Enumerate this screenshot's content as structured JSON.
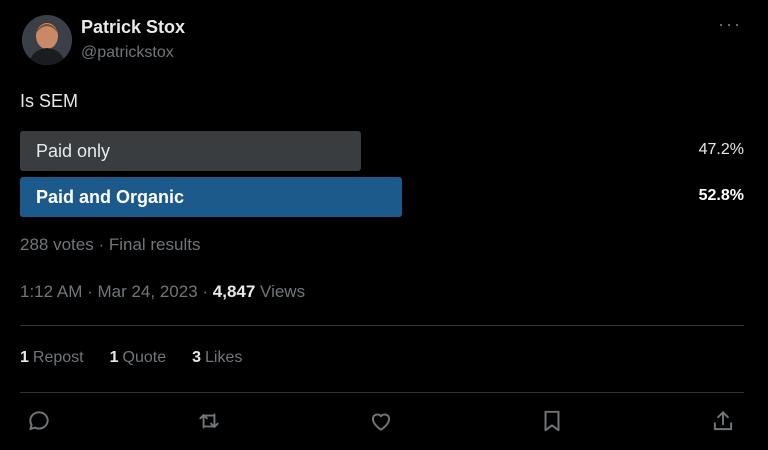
{
  "author": {
    "name": "Patrick Stox",
    "handle": "@patrickstox"
  },
  "tweet": {
    "text": "Is SEM"
  },
  "poll": {
    "options": [
      {
        "label": "Paid only",
        "percent": "47.2%",
        "value": 47.2,
        "winner": false
      },
      {
        "label": "Paid and Organic",
        "percent": "52.8%",
        "value": 52.8,
        "winner": true
      }
    ],
    "summary": "288 votes · Final results"
  },
  "meta": {
    "time": "1:12 AM · Mar 24, 2023 · ",
    "views_count": "4,847",
    "views_label": " Views"
  },
  "stats": {
    "reposts_count": "1",
    "reposts_label": "Repost",
    "quotes_count": "1",
    "quotes_label": "Quote",
    "likes_count": "3",
    "likes_label": "Likes"
  },
  "more_icon": "···",
  "icons": [
    "reply-icon",
    "repost-icon",
    "like-icon",
    "bookmark-icon",
    "share-icon"
  ],
  "colors": {
    "bar_default": "#3a3d40",
    "bar_winner": "#1d5a8c",
    "muted": "#71767b"
  }
}
